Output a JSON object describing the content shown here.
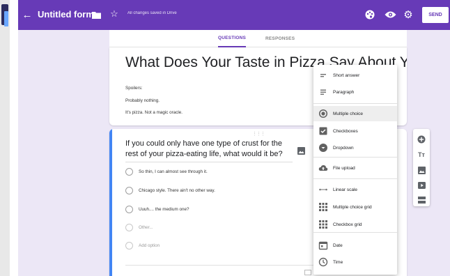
{
  "app": {
    "title": "Untitled form",
    "save_status": "All changes saved in Drive",
    "send_label": "SEND",
    "icons": [
      "back-arrow-icon",
      "folder-icon",
      "star-icon",
      "palette-icon",
      "preview-eye-icon",
      "gear-icon"
    ],
    "accent_color": "#673ab7"
  },
  "tabs": [
    {
      "label": "QUESTIONS",
      "active": true
    },
    {
      "label": "RESPONSES",
      "active": false
    }
  ],
  "form": {
    "title": "What Does Your Taste in Pizza Say About You?",
    "description": [
      "Spoilers:",
      "Probably nothing.",
      "It's pizza. Not a magic oracle."
    ]
  },
  "question": {
    "text": "If you could only have one type of crust for the rest of your pizza-eating life, what would it be?",
    "options": [
      "So thin, I can almost see through it.",
      "Chicago style. There ain't no other way.",
      "Uuuh.... the medium one?",
      "Other...",
      "Add option"
    ]
  },
  "type_menu": {
    "selected": "Multiple choice",
    "items": [
      {
        "label": "Short answer",
        "icon": "short-answer-icon"
      },
      {
        "label": "Paragraph",
        "icon": "paragraph-icon"
      },
      {
        "label": "Multiple choice",
        "icon": "radio-button-icon"
      },
      {
        "label": "Checkboxes",
        "icon": "checkbox-icon"
      },
      {
        "label": "Dropdown",
        "icon": "dropdown-icon"
      },
      {
        "label": "File upload",
        "icon": "cloud-upload-icon"
      },
      {
        "label": "Linear scale",
        "icon": "linear-scale-icon"
      },
      {
        "label": "Multiple choice grid",
        "icon": "grid-icon"
      },
      {
        "label": "Checkbox grid",
        "icon": "checkbox-grid-icon"
      },
      {
        "label": "Date",
        "icon": "calendar-icon"
      },
      {
        "label": "Time",
        "icon": "clock-icon"
      }
    ]
  },
  "side_tools": [
    "add-question-icon",
    "add-title-icon",
    "add-image-icon",
    "add-video-icon",
    "add-section-icon"
  ]
}
